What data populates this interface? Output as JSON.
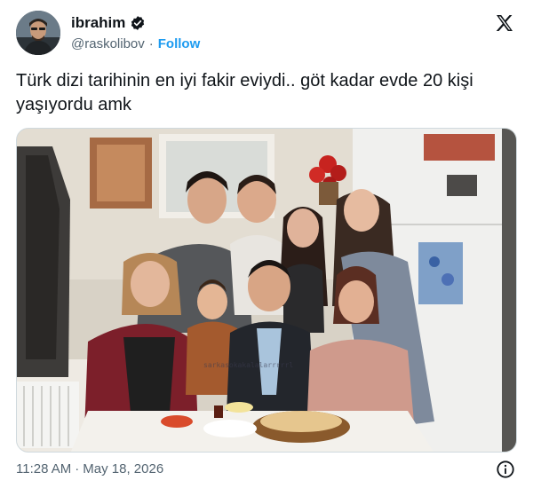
{
  "author": {
    "display_name": "ibrahim",
    "handle": "@raskolibov",
    "follow_label": "Follow",
    "verified": true
  },
  "tweet": {
    "text": "Türk dizi tarihinin en iyi fakir eviydi.. göt kadar evde 20 kişi yaşıyordu amk"
  },
  "media": {
    "watermark": "sarkasokakalalarrrrrl"
  },
  "footer": {
    "time": "11:28 AM",
    "separator": "·",
    "date": "May 18, 2026"
  },
  "colors": {
    "text": "#0f1419",
    "secondary": "#536471",
    "accent": "#1d9bf0"
  },
  "icons": [
    "verified-badge-icon",
    "x-logo-icon",
    "info-icon"
  ]
}
